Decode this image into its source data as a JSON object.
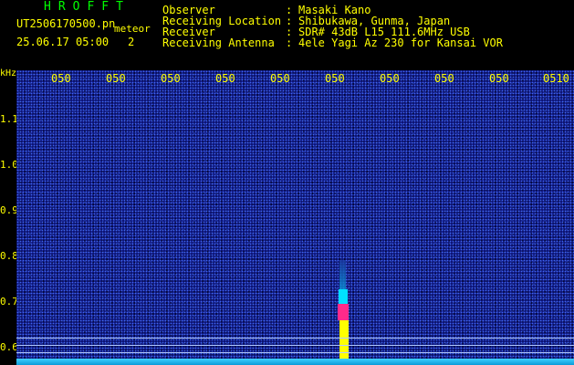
{
  "header": {
    "app_title": "HROFFT",
    "filename": "UT2506170500.pn",
    "tag": "meteor",
    "datetime": "25.06.17 05:00",
    "counter": "2",
    "fields": [
      {
        "label": "Observer",
        "value": "Masaki Kano"
      },
      {
        "label": "Receiving Location",
        "value": "Shibukawa, Gunma, Japan"
      },
      {
        "label": "Receiver",
        "value": "SDR# 43dB L15 111.6MHz USB"
      },
      {
        "label": "Receiving Antenna",
        "value": "4ele Yagi Az 230 for Kansai VOR"
      }
    ]
  },
  "axis": {
    "y_unit": "kHz",
    "y_ticks": [
      "1.1",
      "1.0",
      "0.9",
      "0.8",
      "0.7",
      "0.6"
    ],
    "x_ticks": [
      "050",
      "050",
      "050",
      "050",
      "050",
      "050",
      "050",
      "050",
      "050",
      "050"
    ],
    "x_tick_last": "0510"
  },
  "colors": {
    "text": "#ffff00",
    "title": "#00ff00",
    "background": "#0a0f6e",
    "echo_core": "#ffff00",
    "echo_mid": "#ff2a8a",
    "echo_low": "#00e0ff"
  }
}
